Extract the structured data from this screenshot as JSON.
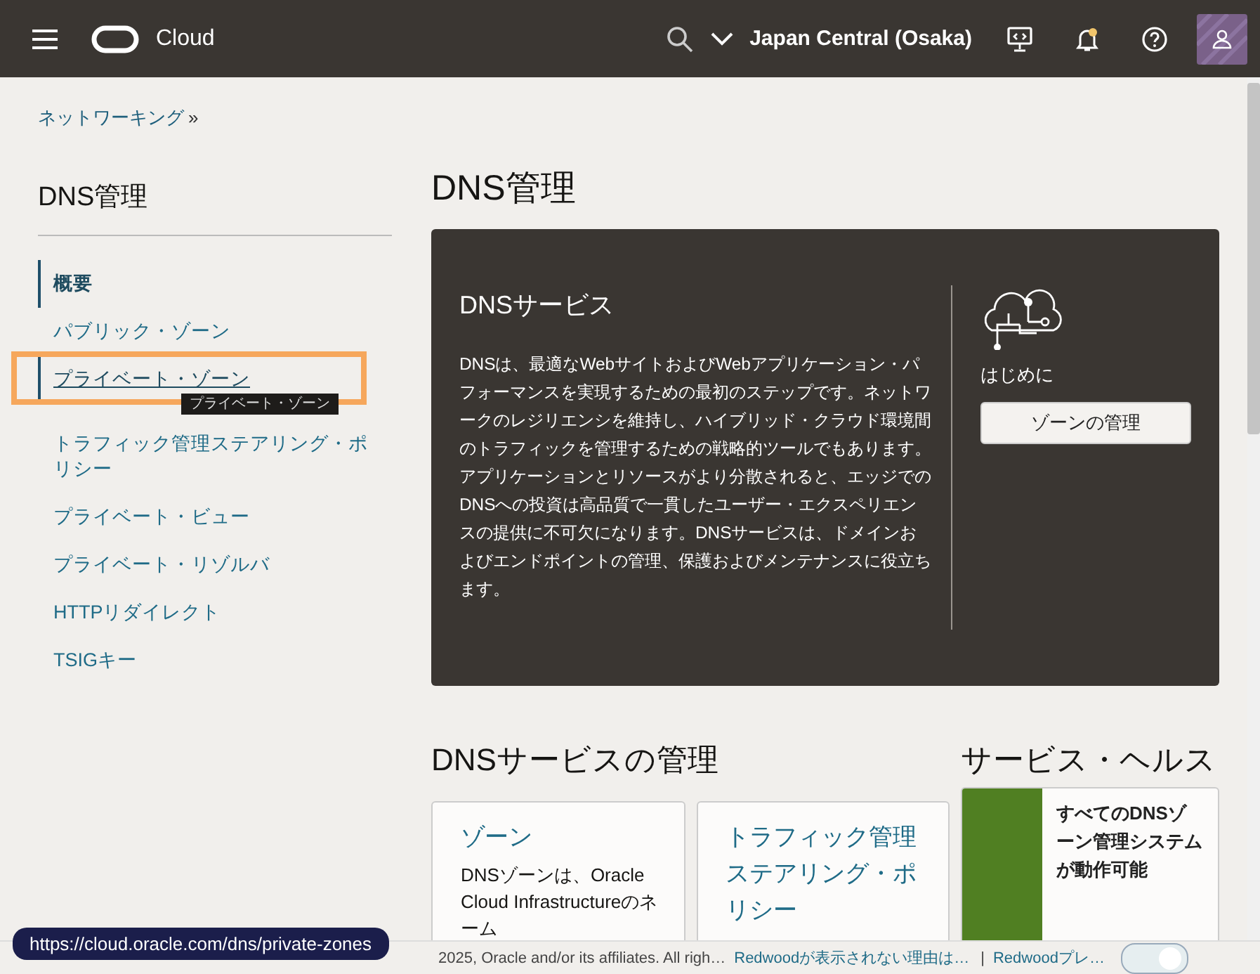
{
  "header": {
    "brand": "Cloud",
    "region": "Japan Central (Osaka)",
    "notification_dot": true
  },
  "breadcrumb": {
    "label": "ネットワーキング",
    "separator": "»"
  },
  "sidebar": {
    "title": "DNS管理",
    "items": [
      {
        "label": "概要",
        "selected": true,
        "hovered": false
      },
      {
        "label": "パブリック・ゾーン",
        "selected": false,
        "hovered": false
      },
      {
        "label": "プライベート・ゾーン",
        "selected": false,
        "hovered": true
      },
      {
        "label": "トラフィック管理ステアリング・ポリシー",
        "selected": false,
        "hovered": false
      },
      {
        "label": "プライベート・ビュー",
        "selected": false,
        "hovered": false
      },
      {
        "label": "プライベート・リゾルバ",
        "selected": false,
        "hovered": false
      },
      {
        "label": "HTTPリダイレクト",
        "selected": false,
        "hovered": false
      },
      {
        "label": "TSIGキー",
        "selected": false,
        "hovered": false
      }
    ],
    "tooltip": "プライベート・ゾーン"
  },
  "page_title": "DNS管理",
  "hero": {
    "title": "DNSサービス",
    "text": "DNSは、最適なWebサイトおよびWebアプリケーション・パフォーマンスを実現するための最初のステップです。ネットワークのレジリエンシを維持し、ハイブリッド・クラウド環境間のトラフィックを管理するための戦略的ツールでもあります。アプリケーションとリソースがより分散されると、エッジでのDNSへの投資は高品質で一貫したユーザー・エクスペリエンスの提供に不可欠になります。DNSサービスは、ドメインおよびエンドポイントの管理、保護およびメンテナンスに役立ちます。",
    "side_label": "はじめに",
    "button": "ゾーンの管理"
  },
  "manage": {
    "title": "DNSサービスの管理",
    "cards": [
      {
        "title": "ゾーン",
        "text": "DNSゾーンは、Oracle Cloud Infrastructureのネーム"
      },
      {
        "title": "トラフィック管理ステアリング・ポリシー"
      }
    ]
  },
  "health": {
    "title": "サービス・ヘルス",
    "message": "すべてのDNSゾーン管理システムが動作可能"
  },
  "footer": {
    "copyright": "2025, Oracle and/or its affiliates. All righ…",
    "links": [
      "Redwoodが表示されない理由は…",
      "Redwoodプレ…"
    ],
    "separator": "|",
    "toggle": {
      "on": true
    }
  },
  "status_url": "https://cloud.oracle.com/dns/private-zones"
}
